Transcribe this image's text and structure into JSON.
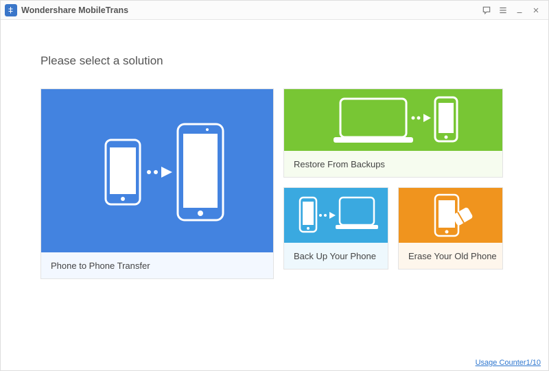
{
  "app": {
    "title": "Wondershare MobileTrans"
  },
  "heading": "Please select a solution",
  "tiles": {
    "phone_to_phone": "Phone to Phone Transfer",
    "restore": "Restore From Backups",
    "backup": "Back Up Your Phone",
    "erase": "Erase Your Old Phone"
  },
  "footer": {
    "usage_counter": "Usage Counter1/10"
  }
}
